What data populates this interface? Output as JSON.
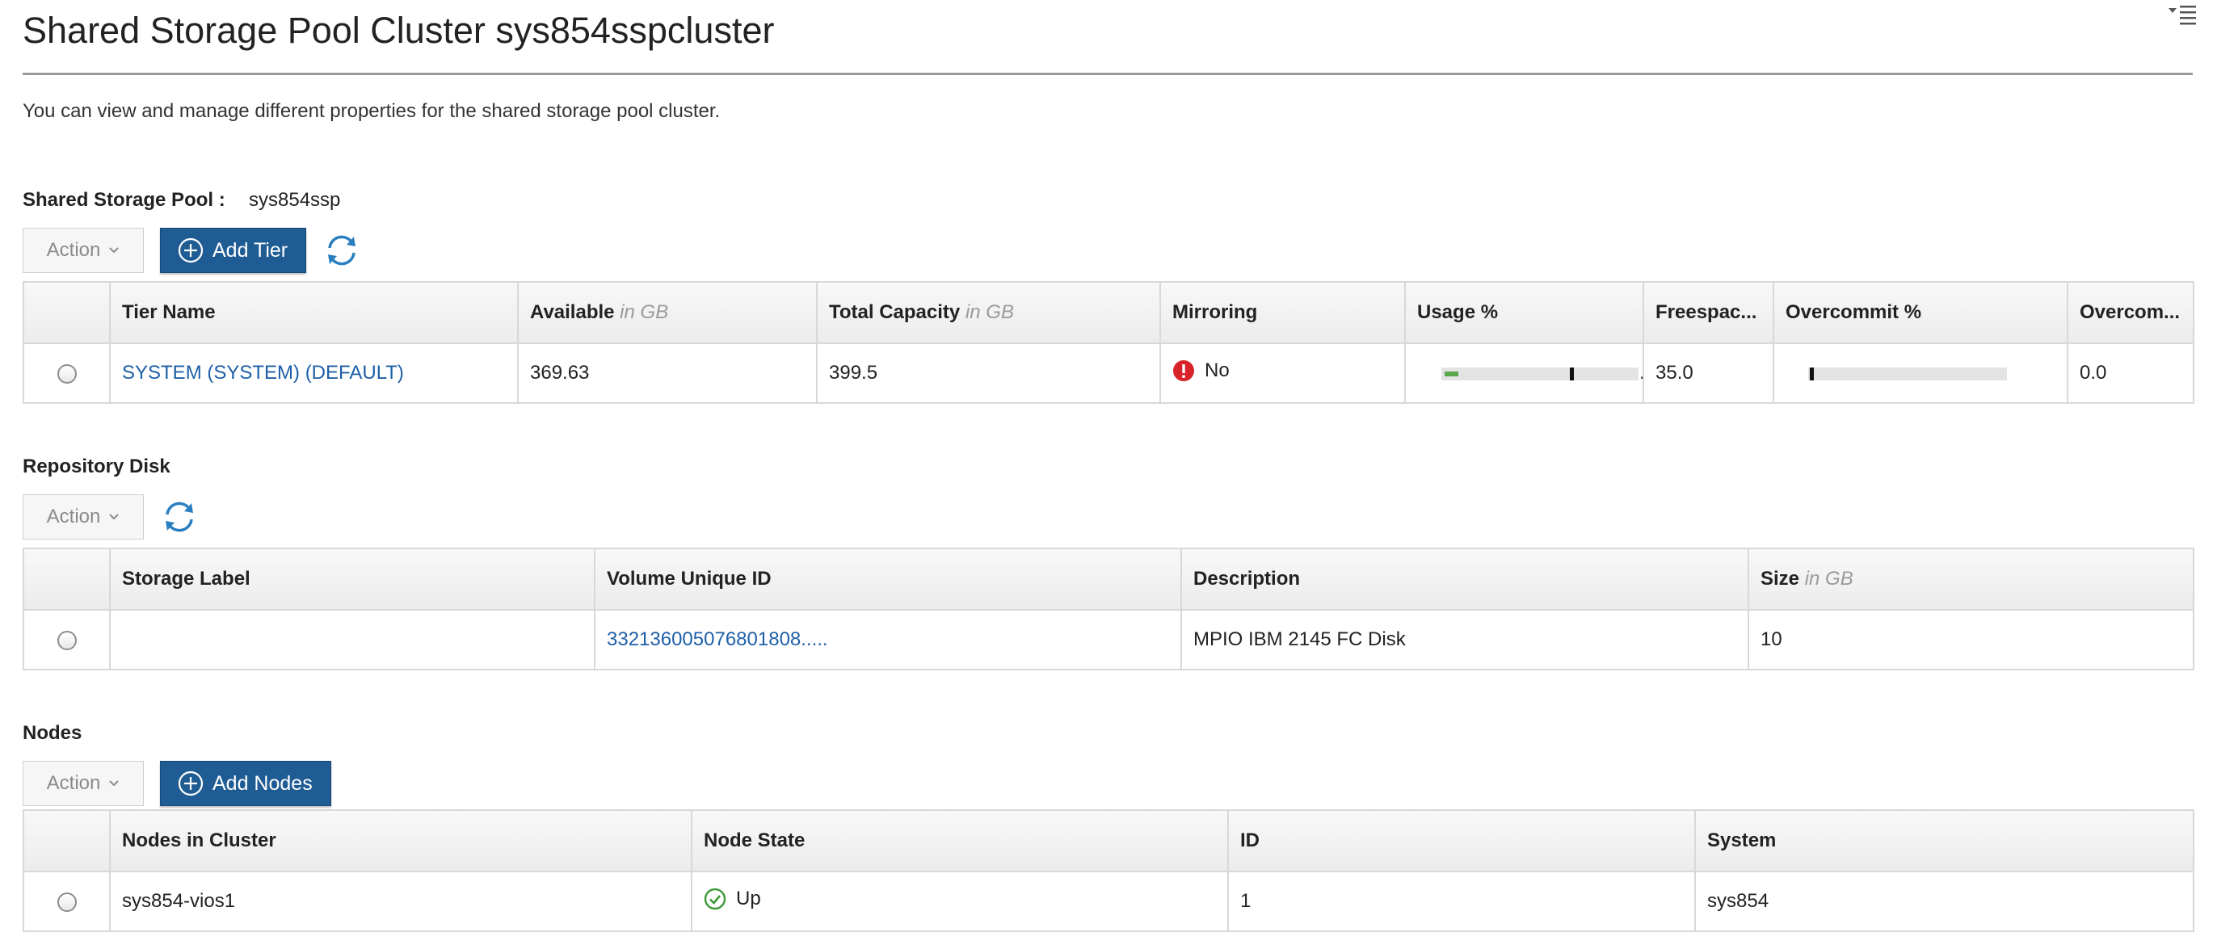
{
  "page": {
    "title": "Shared Storage Pool Cluster sys854sspcluster",
    "description": "You can view and manage different properties for the shared storage pool cluster.",
    "menu_icon": "menu-list-icon"
  },
  "ssp": {
    "label": "Shared Storage Pool :",
    "value": "sys854ssp"
  },
  "tiers": {
    "toolbar": {
      "action_label": "Action",
      "add_label": "Add Tier",
      "refresh_icon": "refresh-icon",
      "add_icon": "plus-circle-icon"
    },
    "columns": {
      "tier_name": "Tier Name",
      "available": "Available",
      "available_unit": "in GB",
      "total_capacity": "Total Capacity",
      "total_capacity_unit": "in GB",
      "mirroring": "Mirroring",
      "usage": "Usage %",
      "freespace": "Freespac...",
      "overcommit_pct": "Overcommit %",
      "overcommit": "Overcom..."
    },
    "rows": [
      {
        "tier_name": "SYSTEM (SYSTEM) (DEFAULT)",
        "available": "369.63",
        "total_capacity": "399.5",
        "mirroring": "No",
        "mirroring_icon": "error-icon",
        "usage_fraction": 0.07,
        "usage_threshold_fraction": 0.65,
        "freespace": "35.0",
        "overcommit_threshold_fraction": 0.0,
        "overcommit": "0.0"
      }
    ]
  },
  "repository": {
    "title": "Repository Disk",
    "toolbar": {
      "action_label": "Action",
      "refresh_icon": "refresh-icon"
    },
    "columns": {
      "storage_label": "Storage Label",
      "volume_id": "Volume Unique ID",
      "description": "Description",
      "size": "Size",
      "size_unit": "in GB"
    },
    "rows": [
      {
        "storage_label": "",
        "volume_id": "332136005076801808.....",
        "description": "MPIO IBM 2145 FC Disk",
        "size": "10"
      }
    ]
  },
  "nodes": {
    "title": "Nodes",
    "toolbar": {
      "action_label": "Action",
      "add_label": "Add Nodes",
      "add_icon": "plus-circle-icon"
    },
    "columns": {
      "node": "Nodes in Cluster",
      "state": "Node State",
      "id": "ID",
      "system": "System"
    },
    "rows": [
      {
        "node": "sys854-vios1",
        "state": "Up",
        "state_icon": "check-circle-icon",
        "id": "1",
        "system": "sys854"
      }
    ]
  },
  "colors": {
    "primary_button": "#1f5c94",
    "link": "#1e5fa8",
    "error": "#d8232a",
    "ok": "#3c9a38",
    "usage_fill": "#5aa84a",
    "refresh": "#2a7fc0"
  }
}
